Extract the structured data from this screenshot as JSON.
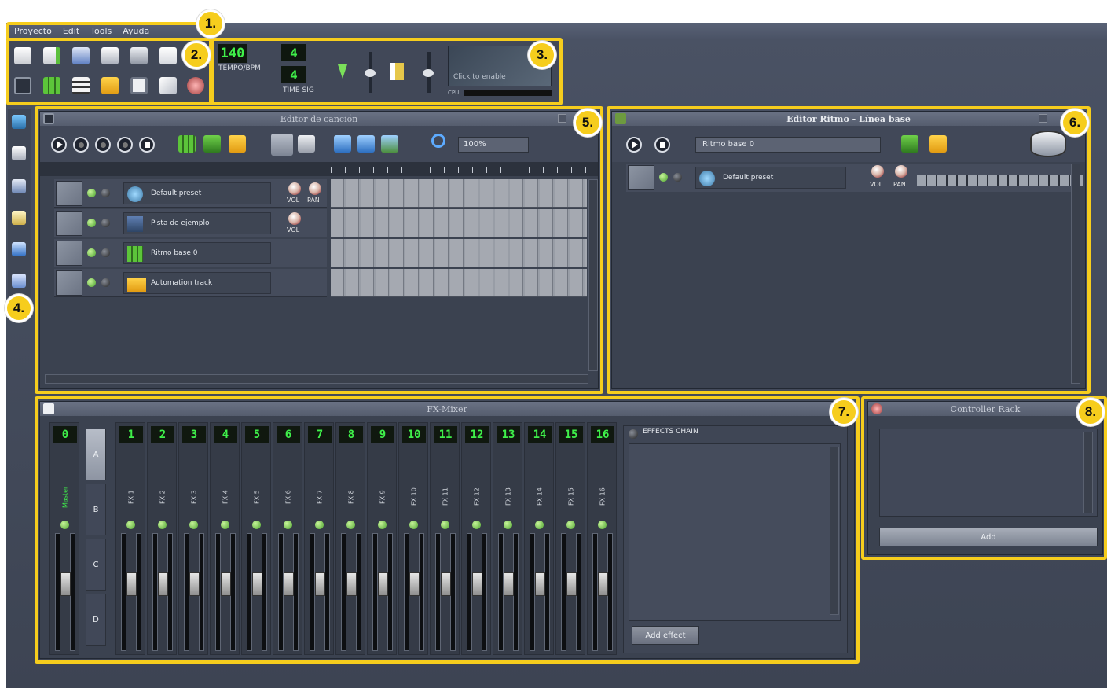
{
  "menu": [
    "Proyecto",
    "Edit",
    "Tools",
    "Ayuda"
  ],
  "badges": [
    "1.",
    "2.",
    "3.",
    "4.",
    "5.",
    "6.",
    "7.",
    "8."
  ],
  "transport": {
    "tempo_value": "140",
    "tempo_label": "TEMPO/BPM",
    "time_sig_num": "4",
    "time_sig_den": "4",
    "time_sig_label": "TIME SIG",
    "oscilloscope_text": "Click to enable",
    "cpu_label": "CPU"
  },
  "toolbar_icons": [
    "new-project-icon",
    "new-from-template-icon",
    "open-project-icon",
    "recent-projects-icon",
    "save-icon",
    "export-icon",
    "song-editor-icon",
    "beat-bassline-icon",
    "piano-roll-icon",
    "automation-editor-icon",
    "fx-mixer-icon",
    "project-notes-icon",
    "controller-rack-icon"
  ],
  "song_editor": {
    "title": "Editor de canción",
    "zoom": "100%",
    "tracks": [
      {
        "name": "Default preset",
        "knobs": [
          "VOL",
          "PAN"
        ],
        "icon": "instrument-icon"
      },
      {
        "name": "Pista de ejemplo",
        "knobs": [
          "VOL"
        ],
        "icon": "sample-track-icon"
      },
      {
        "name": "Ritmo base 0",
        "knobs": [],
        "icon": "beat-track-icon"
      },
      {
        "name": "Automation track",
        "knobs": [],
        "icon": "folder-icon"
      }
    ]
  },
  "bb_editor": {
    "title": "Editor Ritmo - Línea base",
    "pattern_select": "Ritmo base 0",
    "track": {
      "name": "Default preset",
      "knobs": [
        "VOL",
        "PAN"
      ]
    },
    "steps": 16
  },
  "fx_mixer": {
    "title": "FX-Mixer",
    "master": {
      "num": "0",
      "name": "Master"
    },
    "banks": [
      "A",
      "B",
      "C",
      "D"
    ],
    "channels": [
      {
        "num": "1",
        "name": "FX 1"
      },
      {
        "num": "2",
        "name": "FX 2"
      },
      {
        "num": "3",
        "name": "FX 3"
      },
      {
        "num": "4",
        "name": "FX 4"
      },
      {
        "num": "5",
        "name": "FX 5"
      },
      {
        "num": "6",
        "name": "FX 6"
      },
      {
        "num": "7",
        "name": "FX 7"
      },
      {
        "num": "8",
        "name": "FX 8"
      },
      {
        "num": "9",
        "name": "FX 9"
      },
      {
        "num": "10",
        "name": "FX 10"
      },
      {
        "num": "11",
        "name": "FX 11"
      },
      {
        "num": "12",
        "name": "FX 12"
      },
      {
        "num": "13",
        "name": "FX 13"
      },
      {
        "num": "14",
        "name": "FX 14"
      },
      {
        "num": "15",
        "name": "FX 15"
      },
      {
        "num": "16",
        "name": "FX 16"
      }
    ],
    "effects_chain_label": "EFFECTS CHAIN",
    "add_effect_label": "Add effect"
  },
  "controller_rack": {
    "title": "Controller Rack",
    "add_label": "Add"
  },
  "colors": {
    "accent": "#f6cd1d",
    "lcd_green": "#3ff04a",
    "led_green": "#49a12c",
    "panel": "#3b4250"
  }
}
